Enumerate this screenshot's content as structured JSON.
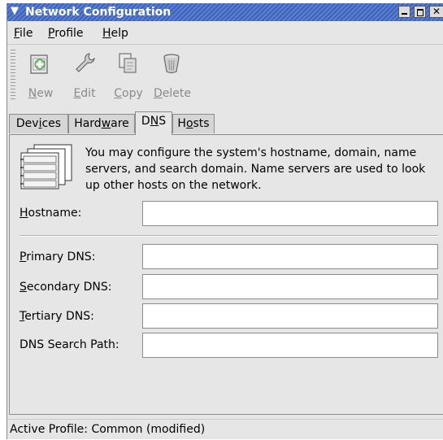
{
  "window": {
    "title": "Network Configuration"
  },
  "menubar": {
    "items": [
      {
        "label": "File",
        "mnemonic": "F",
        "rest": "ile"
      },
      {
        "label": "Profile",
        "mnemonic": "P",
        "rest": "rofile"
      },
      {
        "label": "Help",
        "mnemonic": "H",
        "rest": "elp"
      }
    ]
  },
  "toolbar": {
    "buttons": [
      {
        "label": "New",
        "mnemonic": "N",
        "rest": "ew",
        "icon": "new-icon",
        "enabled": false
      },
      {
        "label": "Edit",
        "mnemonic": "E",
        "rest": "dit",
        "icon": "wrench-icon",
        "enabled": false
      },
      {
        "label": "Copy",
        "mnemonic": "C",
        "rest": "opy",
        "icon": "copy-icon",
        "enabled": false
      },
      {
        "label": "Delete",
        "mnemonic": "D",
        "rest": "elete",
        "icon": "trash-icon",
        "enabled": false
      }
    ]
  },
  "tabs": [
    {
      "label": "Devices",
      "pre": "Dev",
      "mnemonic": "i",
      "post": "ces",
      "active": false
    },
    {
      "label": "Hardware",
      "pre": "Hard",
      "mnemonic": "w",
      "post": "are",
      "active": false
    },
    {
      "label": "DNS",
      "pre": "D",
      "mnemonic": "N",
      "post": "S",
      "active": true
    },
    {
      "label": "Hosts",
      "pre": "H",
      "mnemonic": "o",
      "post": "sts",
      "active": false
    }
  ],
  "dns": {
    "description": "You may configure the system's hostname, domain, name servers, and search domain. Name servers are used to look up other hosts on the network.",
    "fields": {
      "hostname": {
        "label": "Hostname:",
        "mnemonic": "H",
        "rest": "ostname:",
        "value": ""
      },
      "primary": {
        "label": "Primary DNS:",
        "mnemonic": "P",
        "rest": "rimary DNS:",
        "value": ""
      },
      "secondary": {
        "label": "Secondary DNS:",
        "mnemonic": "S",
        "rest": "econdary DNS:",
        "value": ""
      },
      "tertiary": {
        "label": "Tertiary DNS:",
        "mnemonic": "T",
        "rest": "ertiary DNS:",
        "value": ""
      },
      "search_path": {
        "label": "DNS Search Path:",
        "value": ""
      }
    }
  },
  "statusbar": {
    "text": "Active Profile: Common (modified)"
  },
  "colors": {
    "titlebar": "#4a6fc4",
    "window_bg": "#e6e6e6",
    "disabled_text": "#8a8a8a"
  }
}
